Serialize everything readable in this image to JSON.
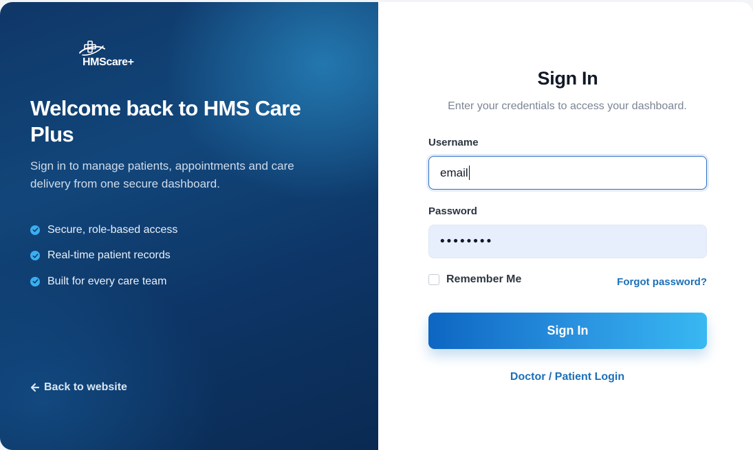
{
  "brand": {
    "logo_text": "HMScare+",
    "logo_icon": "cross-orbit-icon",
    "colors": {
      "panel_dark": "#0f3768",
      "accent": "#38b8f2",
      "link": "#1b6fb8",
      "button_start": "#0d66c2",
      "button_end": "#38b8f2"
    }
  },
  "left_panel": {
    "heading": "Welcome back to HMS Care Plus",
    "subtitle": "Sign in to manage patients, appointments and care delivery from one secure dashboard.",
    "features": [
      {
        "label": "Secure, role-based access",
        "icon": "check-circle-icon"
      },
      {
        "label": "Real-time patient records",
        "icon": "check-circle-icon"
      },
      {
        "label": "Built for every care team",
        "icon": "check-circle-icon"
      }
    ],
    "back_link": {
      "label": "Back to website",
      "icon": "arrow-left-icon"
    }
  },
  "form": {
    "title": "Sign In",
    "description": "Enter your credentials to access your dashboard.",
    "username": {
      "label": "Username",
      "value": "email"
    },
    "password": {
      "label": "Password",
      "value": "••••••••"
    },
    "remember_label": "Remember Me",
    "remember_checked": false,
    "forgot_label": "Forgot password?",
    "submit_label": "Sign In",
    "alt_login_label": "Doctor / Patient Login"
  }
}
